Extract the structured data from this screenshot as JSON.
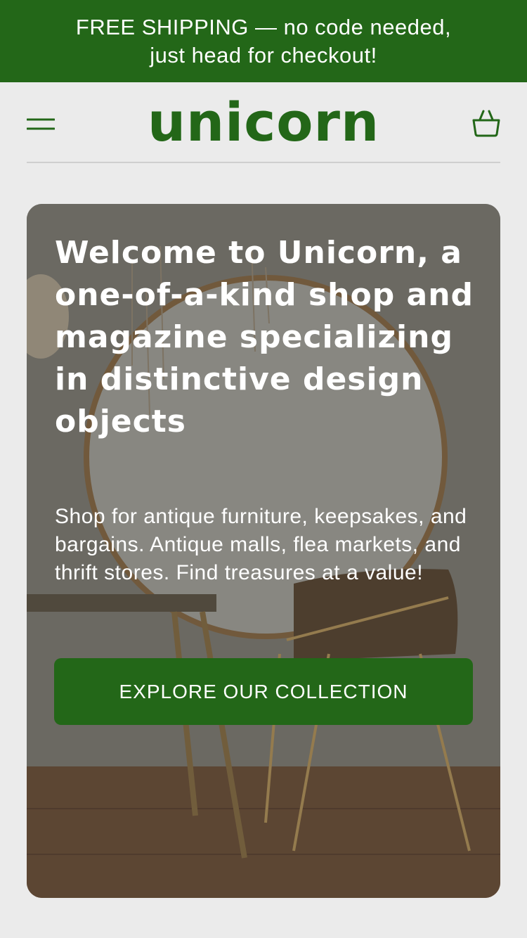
{
  "promo_banner": {
    "line1": "FREE SHIPPING — no code needed,",
    "line2": "just head for checkout!"
  },
  "header": {
    "logo_text": "unicorn",
    "menu_icon": "hamburger-menu-icon",
    "cart_icon": "shopping-basket-icon"
  },
  "hero": {
    "title": "Welcome to Unicorn, a one-of-a-kind shop and magazine specializing in distinctive design objects",
    "subtitle": "Shop for antique furniture, keepsakes, and bargains. Antique malls, flea markets, and thrift stores. Find treasures at a value!",
    "cta_label": "EXPLORE OUR COLLECTION"
  },
  "colors": {
    "brand_green": "#236718",
    "page_background": "#ebebeb",
    "text_on_dark": "#ffffff"
  }
}
